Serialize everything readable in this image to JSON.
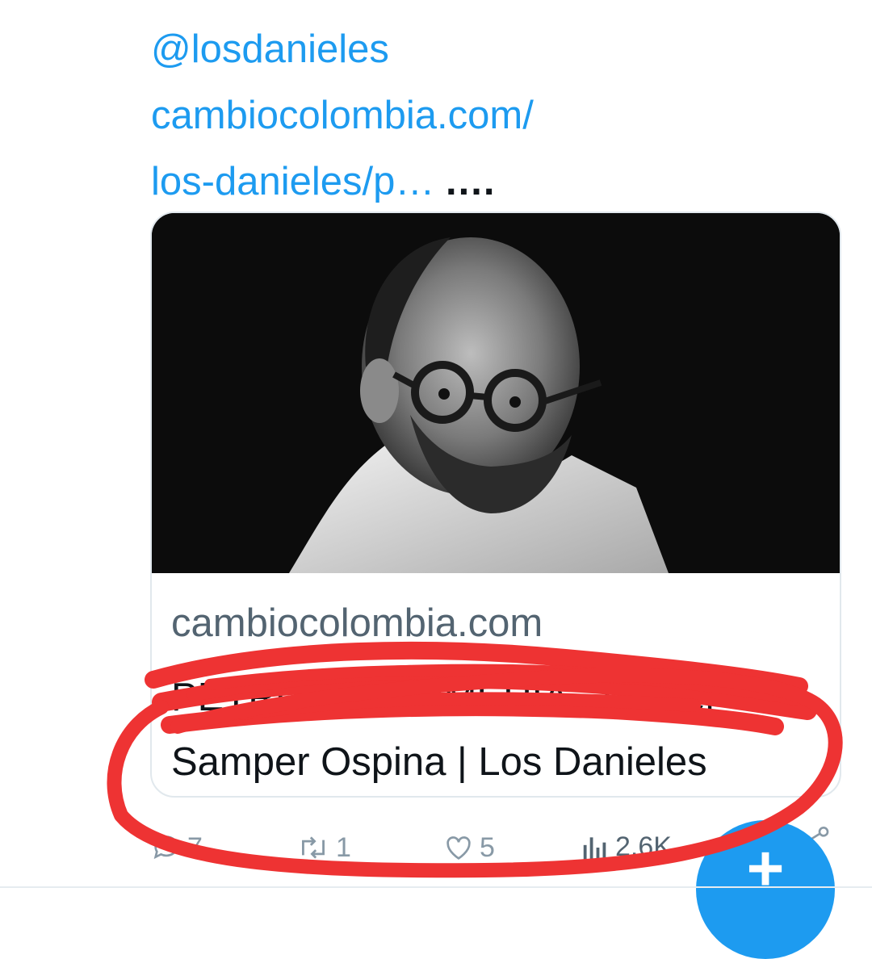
{
  "tweet": {
    "mention": "@losdanieles",
    "link_line1": "cambiocolombia.com/",
    "link_line2": "los-danieles/p…",
    "trailing": "...."
  },
  "card": {
    "domain": "cambiocolombia.com",
    "title_line1": "PETRO ES MUMERÍA - Daniel",
    "title_line2": "Samper Ospina | Los Danieles"
  },
  "actions": {
    "replies": "7",
    "retweets": "1",
    "likes": "5",
    "views": "2.6K"
  },
  "fab": {
    "label": "+"
  },
  "colors": {
    "link": "#1d9bf0",
    "annotation": "#ee3333",
    "icon": "#8899a6"
  }
}
